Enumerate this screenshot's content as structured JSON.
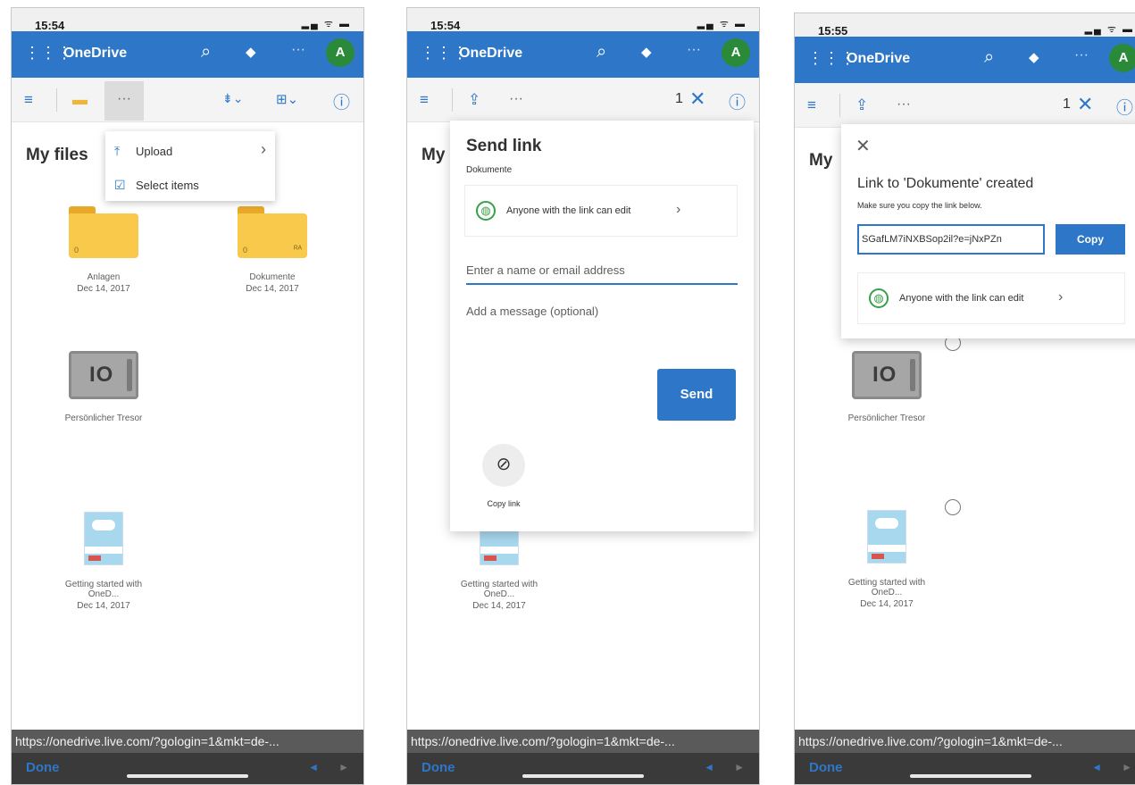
{
  "status": {
    "time_1": "15:54",
    "time_2": "15:54",
    "time_3": "15:55",
    "icons": "▂▄ ᯤ ▬"
  },
  "appbar": {
    "title": "OneDrive",
    "avatar_initial": "A"
  },
  "icons": {
    "waffle": "⋮⋮⋮",
    "search": "⌕",
    "diamond": "◆",
    "more": "···",
    "hamburger": "≡",
    "folder": "▬",
    "sort": "⇟⌄",
    "grid": "⊞⌄",
    "info": "ⓘ",
    "share": "⇪",
    "close": "✕",
    "upload": "⤒",
    "check": "☑",
    "chevron_right": "›",
    "globe": "◍",
    "link": "⊘",
    "nav_back": "◄",
    "nav_fwd": "►"
  },
  "commandbar": {
    "selected_count": "1"
  },
  "page": {
    "title": "My files"
  },
  "items": [
    {
      "name": "Anlagen",
      "date": "Dec 14, 2017",
      "count": "0"
    },
    {
      "name": "Dokumente",
      "date": "Dec 14, 2017",
      "count": "0"
    },
    {
      "name": "Persönlicher Tresor",
      "date": ""
    },
    {
      "name": "Getting started with OneD...",
      "date": "Dec 14, 2017"
    }
  ],
  "dropdown": {
    "upload": "Upload",
    "select_items": "Select items"
  },
  "send_link": {
    "title": "Send link",
    "item": "Dokumente",
    "permission": "Anyone with the link can edit",
    "name_placeholder": "Enter a name or email address",
    "message_placeholder": "Add a message (optional)",
    "send": "Send",
    "copy_link": "Copy link"
  },
  "link_created": {
    "title": "Link to 'Dokumente' created",
    "subtitle": "Make sure you copy the link below.",
    "url": "SGafLM7iNXBSop2il?e=jNxPZn",
    "copy": "Copy",
    "permission": "Anyone with the link can edit"
  },
  "browser": {
    "url": "https://onedrive.live.com/?gologin=1&mkt=de-...",
    "url_3": "https://onedrive.live.com/?gologin=1&mkt=de-...",
    "done": "Done"
  }
}
